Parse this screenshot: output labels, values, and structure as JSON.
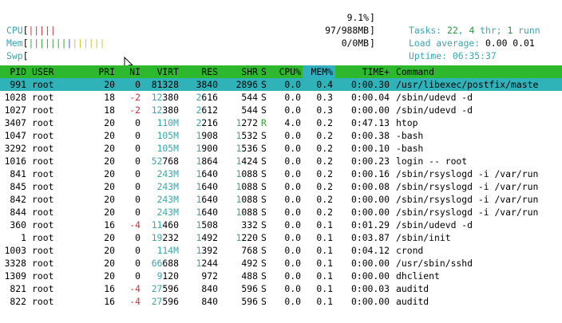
{
  "meters": {
    "cpu": {
      "label": "CPU",
      "bars": "|||||",
      "value": "9.1%"
    },
    "mem": {
      "label": "Mem",
      "bars_green": "|||||||",
      "bars_blue": "|",
      "bars_yellow": "||||||",
      "value": "97/988MB"
    },
    "swp": {
      "label": "Swp",
      "value": "0/0MB"
    }
  },
  "summary": {
    "tasks_label": "Tasks: ",
    "tasks_value": "22",
    "tasks_sep": ", ",
    "thr_value": "4",
    "thr_label": " thr; ",
    "running_value": "1",
    "running_label": " runn",
    "load_label": "Load average: ",
    "load_values": "0.00 0.01",
    "uptime_label": "Uptime: ",
    "uptime_value": "06:35:37"
  },
  "columns": [
    "PID",
    "USER",
    "PRI",
    "NI",
    "VIRT",
    "RES",
    "SHR",
    "S",
    "CPU%",
    "MEM%",
    "TIME+",
    "Command"
  ],
  "processes": [
    [
      "991",
      "root",
      "20",
      "0",
      "81328",
      "3840",
      "2896",
      "S",
      "0.0",
      "0.4",
      "0:00.30",
      "/usr/libexec/postfix/maste"
    ],
    [
      "1028",
      "root",
      "18",
      "-2",
      "12380",
      "2616",
      "544",
      "S",
      "0.0",
      "0.3",
      "0:00.04",
      "/sbin/udevd -d"
    ],
    [
      "1027",
      "root",
      "18",
      "-2",
      "12380",
      "2612",
      "544",
      "S",
      "0.0",
      "0.3",
      "0:00.00",
      "/sbin/udevd -d"
    ],
    [
      "3407",
      "root",
      "20",
      "0",
      "110M",
      "2216",
      "1272",
      "R",
      "4.0",
      "0.2",
      "0:47.13",
      "htop"
    ],
    [
      "1047",
      "root",
      "20",
      "0",
      "105M",
      "1908",
      "1532",
      "S",
      "0.0",
      "0.2",
      "0:00.38",
      "-bash"
    ],
    [
      "3292",
      "root",
      "20",
      "0",
      "105M",
      "1900",
      "1536",
      "S",
      "0.0",
      "0.2",
      "0:00.10",
      "-bash"
    ],
    [
      "1016",
      "root",
      "20",
      "0",
      "52768",
      "1864",
      "1424",
      "S",
      "0.0",
      "0.2",
      "0:00.23",
      "login -- root"
    ],
    [
      "841",
      "root",
      "20",
      "0",
      "243M",
      "1640",
      "1088",
      "S",
      "0.0",
      "0.2",
      "0:00.16",
      "/sbin/rsyslogd -i /var/run"
    ],
    [
      "845",
      "root",
      "20",
      "0",
      "243M",
      "1640",
      "1088",
      "S",
      "0.0",
      "0.2",
      "0:00.08",
      "/sbin/rsyslogd -i /var/run"
    ],
    [
      "842",
      "root",
      "20",
      "0",
      "243M",
      "1640",
      "1088",
      "S",
      "0.0",
      "0.2",
      "0:00.00",
      "/sbin/rsyslogd -i /var/run"
    ],
    [
      "844",
      "root",
      "20",
      "0",
      "243M",
      "1640",
      "1088",
      "S",
      "0.0",
      "0.2",
      "0:00.00",
      "/sbin/rsyslogd -i /var/run"
    ],
    [
      "360",
      "root",
      "16",
      "-4",
      "11460",
      "1508",
      "332",
      "S",
      "0.0",
      "0.1",
      "0:01.29",
      "/sbin/udevd -d"
    ],
    [
      "1",
      "root",
      "20",
      "0",
      "19232",
      "1492",
      "1220",
      "S",
      "0.0",
      "0.1",
      "0:03.87",
      "/sbin/init"
    ],
    [
      "1003",
      "root",
      "20",
      "0",
      "114M",
      "1392",
      "768",
      "S",
      "0.0",
      "0.1",
      "0:04.12",
      "crond"
    ],
    [
      "3328",
      "root",
      "20",
      "0",
      "66688",
      "1244",
      "492",
      "S",
      "0.0",
      "0.1",
      "0:00.00",
      "/usr/sbin/sshd"
    ],
    [
      "1309",
      "root",
      "20",
      "0",
      "9120",
      "972",
      "488",
      "S",
      "0.0",
      "0.1",
      "0:00.00",
      "dhclient"
    ],
    [
      "821",
      "root",
      "16",
      "-4",
      "27596",
      "840",
      "596",
      "S",
      "0.0",
      "0.1",
      "0:00.03",
      "auditd"
    ],
    [
      "822",
      "root",
      "16",
      "-4",
      "27596",
      "840",
      "596",
      "S",
      "0.0",
      "0.1",
      "0:00.00",
      "auditd"
    ]
  ],
  "selected_row": 0,
  "sorted_column": "MEM%",
  "colors": {
    "header_bg": "#2eb82e",
    "selected_bg": "#2fb2b8",
    "sorted_bg": "#30b0c0",
    "accent_cyan": "#3aa6ad",
    "negative_red": "#c8323b"
  }
}
